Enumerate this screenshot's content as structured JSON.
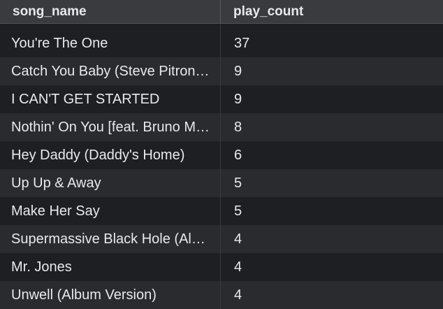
{
  "table": {
    "columns": [
      "song_name",
      "play_count"
    ],
    "rows": [
      {
        "song_name": "You're The One",
        "play_count": "37"
      },
      {
        "song_name": "Catch You Baby (Steve Pitron & Max Sanna Radio Edit)",
        "play_count": "9"
      },
      {
        "song_name": "I CAN'T GET STARTED",
        "play_count": "9"
      },
      {
        "song_name": "Nothin' On You [feat. Bruno Mars] (Album Version)",
        "play_count": "8"
      },
      {
        "song_name": "Hey Daddy (Daddy's Home)",
        "play_count": "6"
      },
      {
        "song_name": "Up Up & Away",
        "play_count": "5"
      },
      {
        "song_name": "Make Her Say",
        "play_count": "5"
      },
      {
        "song_name": "Supermassive Black Hole (Album Version)",
        "play_count": "4"
      },
      {
        "song_name": "Mr. Jones",
        "play_count": "4"
      },
      {
        "song_name": "Unwell (Album Version)",
        "play_count": "4"
      }
    ]
  }
}
